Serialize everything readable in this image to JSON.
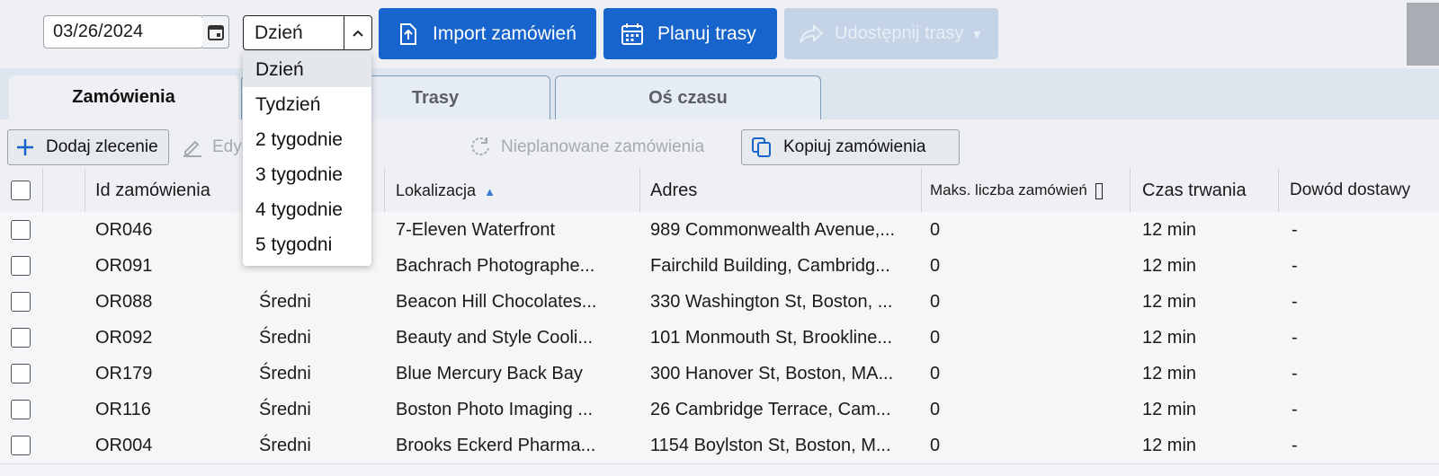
{
  "toolbar": {
    "date_value": "03/26/2024",
    "period_value": "Dzień",
    "import_label": "Import zamówień",
    "plan_label": "Planuj trasy",
    "share_label": "Udostępnij trasy"
  },
  "period_options": [
    "Dzień",
    "Tydzień",
    "2 tygodnie",
    "3 tygodnie",
    "4 tygodnie",
    "5 tygodni"
  ],
  "tabs": [
    {
      "label": "Zamówienia"
    },
    {
      "label": "Trasy"
    },
    {
      "label": "Oś czasu"
    }
  ],
  "actions": {
    "add_label": "Dodaj zlecenie",
    "edit_label": "Edy",
    "unplanned_label": "Nieplanowane zamówienia",
    "copy_label": "Kopiuj zamówienia"
  },
  "table": {
    "headers": {
      "id": "Id zamówienia",
      "location": "Lokalizacja",
      "address": "Adres",
      "max_orders": "Maks. liczba zamówień",
      "duration": "Czas trwania",
      "proof": "Dowód dostawy"
    },
    "rows": [
      {
        "id": "OR046",
        "priority": "",
        "location": "7-Eleven Waterfront",
        "address": "989 Commonwealth Avenue,...",
        "max": "0",
        "duration": "12 min",
        "proof": "-"
      },
      {
        "id": "OR091",
        "priority": "",
        "location": "Bachrach Photographe...",
        "address": "Fairchild Building, Cambridg...",
        "max": "0",
        "duration": "12 min",
        "proof": "-"
      },
      {
        "id": "OR088",
        "priority": "Średni",
        "location": "Beacon Hill Chocolates...",
        "address": "330 Washington St, Boston, ...",
        "max": "0",
        "duration": "12 min",
        "proof": "-"
      },
      {
        "id": "OR092",
        "priority": "Średni",
        "location": "Beauty and Style Cooli...",
        "address": "101 Monmouth St, Brookline...",
        "max": "0",
        "duration": "12 min",
        "proof": "-"
      },
      {
        "id": "OR179",
        "priority": "Średni",
        "location": "Blue Mercury Back Bay",
        "address": "300 Hanover St, Boston, MA...",
        "max": "0",
        "duration": "12 min",
        "proof": "-"
      },
      {
        "id": "OR116",
        "priority": "Średni",
        "location": "Boston Photo Imaging ...",
        "address": "26 Cambridge Terrace, Cam...",
        "max": "0",
        "duration": "12 min",
        "proof": "-"
      },
      {
        "id": "OR004",
        "priority": "Średni",
        "location": "Brooks Eckerd Pharma...",
        "address": "1154 Boylston St, Boston, M...",
        "max": "0",
        "duration": "12 min",
        "proof": "-"
      }
    ]
  },
  "colors": {
    "primary": "#1664cc",
    "disabled": "#c4d3e6",
    "sort_arrow": "#3a7bd5",
    "add_icon": "#1664cc"
  },
  "icons": {
    "calendar": "calendar-icon",
    "chevron": "chevron-up-icon",
    "import": "upload-icon",
    "plan": "calendar-grid-icon",
    "share": "share-arrow-icon",
    "add": "plus-icon",
    "edit": "pencil-icon",
    "unplanned": "refresh-icon",
    "copy": "copy-icon",
    "sort": "sort-ascending-icon"
  }
}
